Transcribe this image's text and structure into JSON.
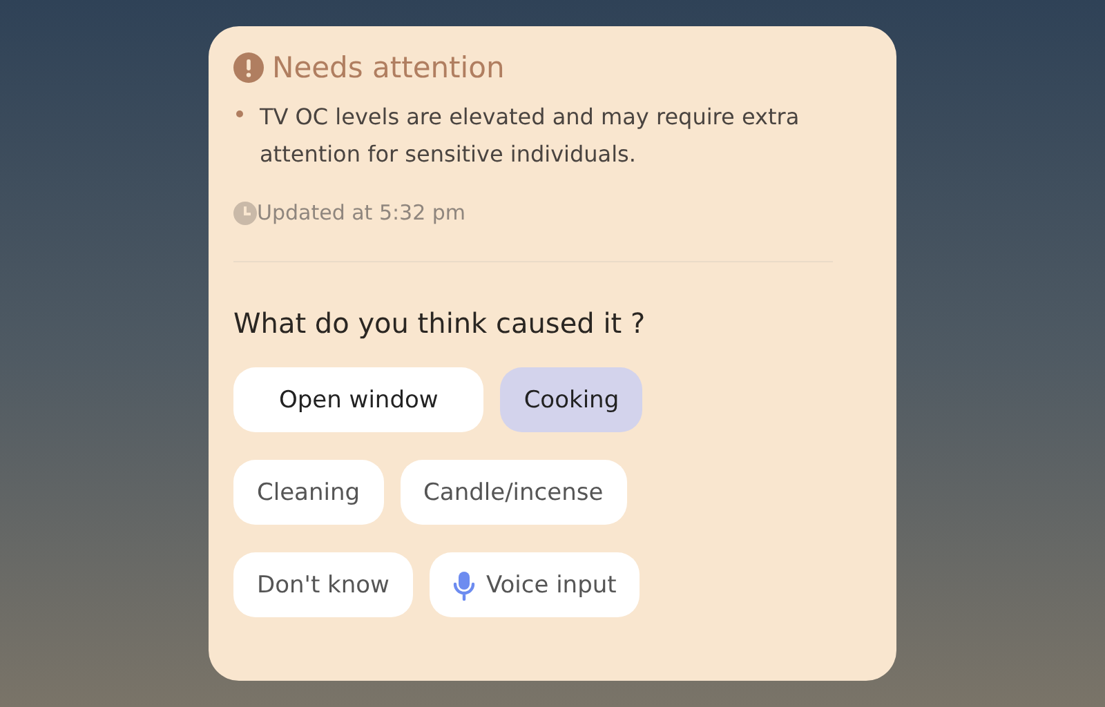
{
  "alert": {
    "title": "Needs attention",
    "bullets": [
      "TV OC levels are elevated and may require extra attention for sensitive individuals."
    ],
    "updated": "Updated at 5:32 pm"
  },
  "question": "What do you think caused it ?",
  "choice_rows": [
    [
      {
        "label": "Open window",
        "kind": "option",
        "selected": false
      },
      {
        "label": "Cooking",
        "kind": "option",
        "selected": true
      }
    ],
    [
      {
        "label": "Cleaning",
        "kind": "option",
        "selected": false
      },
      {
        "label": "Candle/incense",
        "kind": "option",
        "selected": false
      }
    ],
    [
      {
        "label": "Don't know",
        "kind": "option",
        "selected": false
      },
      {
        "label": "Voice input",
        "kind": "voice",
        "selected": false
      }
    ]
  ]
}
